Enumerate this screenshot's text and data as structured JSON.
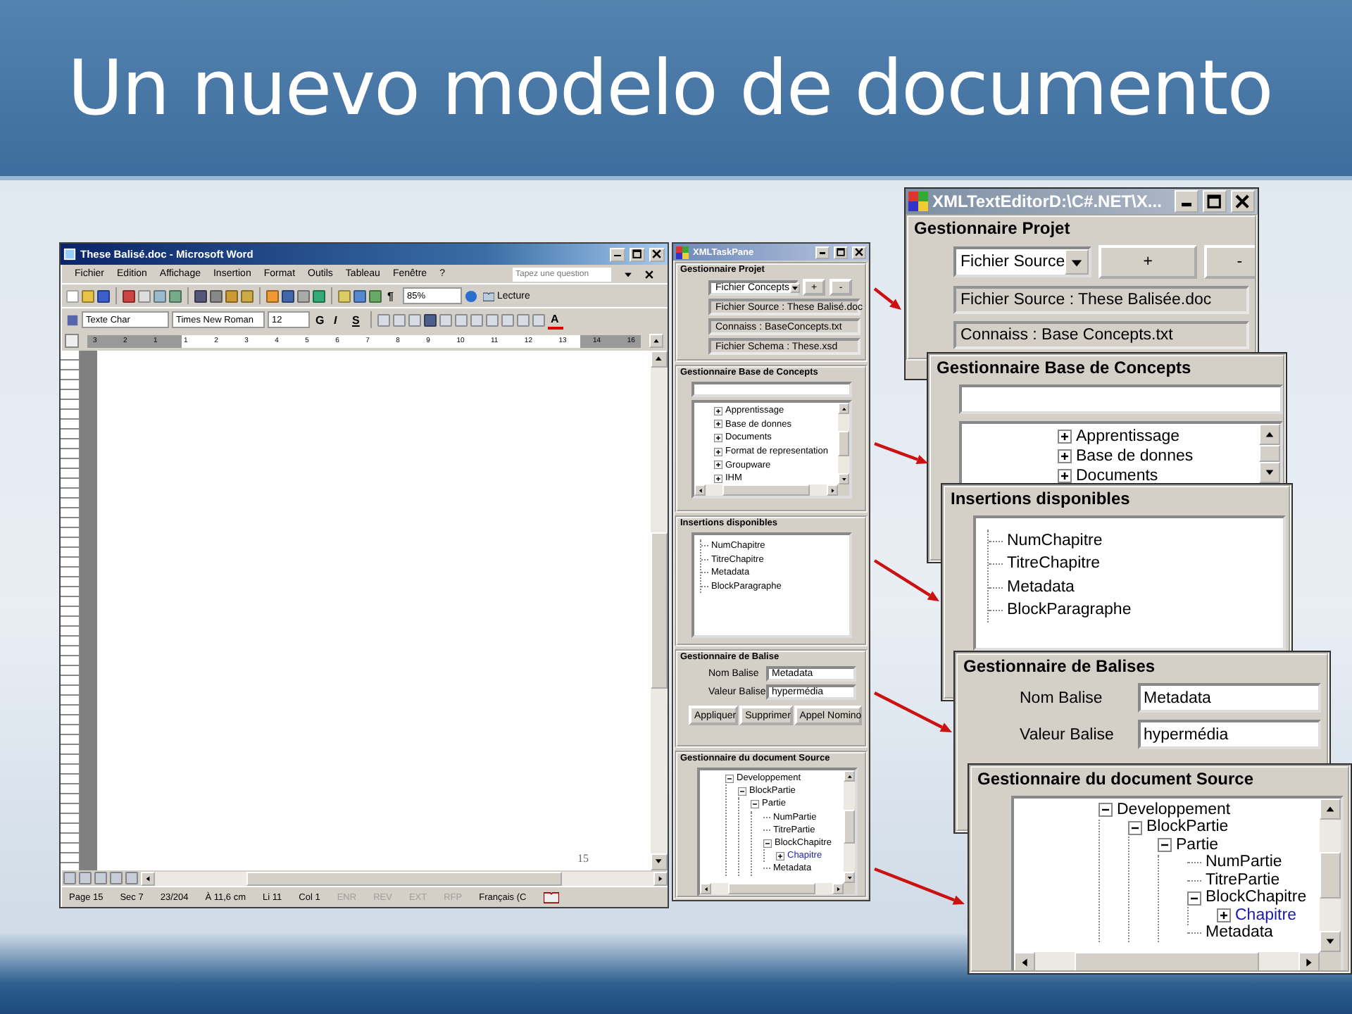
{
  "slide": {
    "title": "Un nuevo modelo de documento"
  },
  "word": {
    "title": "These Balisé.doc - Microsoft Word",
    "menu": [
      "Fichier",
      "Edition",
      "Affichage",
      "Insertion",
      "Format",
      "Outils",
      "Tableau",
      "Fenêtre",
      "?"
    ],
    "help_placeholder": "Tapez une question",
    "marks_glyph": "¶",
    "zoom": "85%",
    "read_button": "Lecture",
    "style": "Texte Char",
    "font": "Times New Roman",
    "size": "12",
    "format_buttons": [
      "G",
      "I",
      "S"
    ],
    "font_color_glyph": "A",
    "ruler": [
      "3",
      "2",
      "1",
      "1",
      "2",
      "3",
      "4",
      "5",
      "6",
      "7",
      "8",
      "9",
      "10",
      "11",
      "12",
      "13",
      "14",
      "16"
    ],
    "page_number": "15",
    "status": [
      {
        "text": "Page 15",
        "disabled": false
      },
      {
        "text": "Sec 7",
        "disabled": false
      },
      {
        "text": "23/204",
        "disabled": false
      },
      {
        "text": "À 11,6 cm",
        "disabled": false
      },
      {
        "text": "Li 11",
        "disabled": false
      },
      {
        "text": "Col 1",
        "disabled": false
      },
      {
        "text": "ENR",
        "disabled": true
      },
      {
        "text": "REV",
        "disabled": true
      },
      {
        "text": "EXT",
        "disabled": true
      },
      {
        "text": "RFP",
        "disabled": true
      },
      {
        "text": "Français (C",
        "disabled": false
      }
    ]
  },
  "taskpane": {
    "title": "XMLTaskPane",
    "project": {
      "heading": "Gestionnaire Projet",
      "combo": "Fichier Concepts",
      "buttons": [
        "+",
        "-"
      ],
      "files": [
        "Fichier Source : These Balisé.doc",
        "Connaiss : BaseConcepts.txt",
        "Fichier Schema : These.xsd"
      ]
    },
    "concepts": {
      "heading": "Gestionnaire Base de Concepts",
      "items": [
        {
          "label": "Apprentissage",
          "kind": "branch",
          "expanded": false,
          "selected": false
        },
        {
          "label": "Base de donnes",
          "kind": "branch",
          "expanded": false,
          "selected": false
        },
        {
          "label": "Documents",
          "kind": "branch",
          "expanded": false,
          "selected": false
        },
        {
          "label": "Format de representation",
          "kind": "branch",
          "expanded": false,
          "selected": false
        },
        {
          "label": "Groupware",
          "kind": "branch",
          "expanded": false,
          "selected": false
        },
        {
          "label": "IHM",
          "kind": "branch",
          "expanded": false,
          "selected": false
        }
      ]
    },
    "insertions": {
      "heading": "Insertions disponibles",
      "items": [
        "NumChapitre",
        "TitreChapitre",
        "Metadata",
        "BlockParagraphe"
      ]
    },
    "tag": {
      "heading": "Gestionnaire de Balise",
      "fields": [
        {
          "label": "Nom Balise",
          "value": "Metadata"
        },
        {
          "label": "Valeur Balise",
          "value": "hypermédia"
        }
      ],
      "buttons": [
        "Appliquer",
        "Supprimer",
        "Appel Nomino"
      ]
    },
    "source": {
      "heading": "Gestionnaire du document Source",
      "tree": [
        {
          "label": "Developpement",
          "kind": "branch",
          "expanded": true,
          "selected": false,
          "children": [
            {
              "label": "BlockPartie",
              "kind": "branch",
              "expanded": true,
              "selected": false,
              "children": [
                {
                  "label": "Partie",
                  "kind": "branch",
                  "expanded": true,
                  "selected": false,
                  "children": [
                    {
                      "label": "NumPartie",
                      "kind": "leaf",
                      "selected": false
                    },
                    {
                      "label": "TitrePartie",
                      "kind": "leaf",
                      "selected": false
                    },
                    {
                      "label": "BlockChapitre",
                      "kind": "branch",
                      "expanded": true,
                      "selected": false,
                      "children": [
                        {
                          "label": "Chapitre",
                          "kind": "branch",
                          "expanded": false,
                          "selected": true
                        }
                      ]
                    },
                    {
                      "label": "Metadata",
                      "kind": "leaf",
                      "selected": false
                    }
                  ]
                }
              ]
            }
          ]
        }
      ]
    }
  },
  "callouts": {
    "editor": {
      "title": "XMLTextEditorD:\\C#.NET\\X...",
      "heading": "Gestionnaire Projet",
      "combo": "Fichier Source",
      "buttons": [
        "+",
        "-"
      ],
      "files": [
        "Fichier Source : These Balisée.doc",
        "Connaiss : Base Concepts.txt"
      ]
    },
    "concepts": {
      "heading": "Gestionnaire Base de Concepts",
      "items": [
        {
          "label": "Apprentissage",
          "kind": "branch",
          "expanded": false,
          "selected": false
        },
        {
          "label": "Base de donnes",
          "kind": "branch",
          "expanded": false,
          "selected": false
        },
        {
          "label": "Documents",
          "kind": "branch",
          "expanded": false,
          "selected": false
        }
      ]
    },
    "insertions": {
      "heading": "Insertions disponibles",
      "items": [
        "NumChapitre",
        "TitreChapitre",
        "Metadata",
        "BlockParagraphe"
      ]
    },
    "tag": {
      "heading": "Gestionnaire de Balises",
      "fields": [
        {
          "label": "Nom Balise",
          "value": "Metadata"
        },
        {
          "label": "Valeur Balise",
          "value": "hypermédia"
        }
      ]
    },
    "source": {
      "heading": "Gestionnaire du document Source",
      "tree": [
        {
          "label": "Developpement",
          "kind": "branch",
          "expanded": true,
          "selected": false,
          "children": [
            {
              "label": "BlockPartie",
              "kind": "branch",
              "expanded": true,
              "selected": false,
              "children": [
                {
                  "label": "Partie",
                  "kind": "branch",
                  "expanded": true,
                  "selected": false,
                  "children": [
                    {
                      "label": "NumPartie",
                      "kind": "leaf",
                      "selected": false
                    },
                    {
                      "label": "TitrePartie",
                      "kind": "leaf",
                      "selected": false
                    },
                    {
                      "label": "BlockChapitre",
                      "kind": "branch",
                      "expanded": true,
                      "selected": false,
                      "children": [
                        {
                          "label": "Chapitre",
                          "kind": "branch",
                          "expanded": false,
                          "selected": true
                        }
                      ]
                    },
                    {
                      "label": "Metadata",
                      "kind": "leaf",
                      "selected": false
                    }
                  ]
                }
              ]
            }
          ]
        }
      ]
    }
  }
}
